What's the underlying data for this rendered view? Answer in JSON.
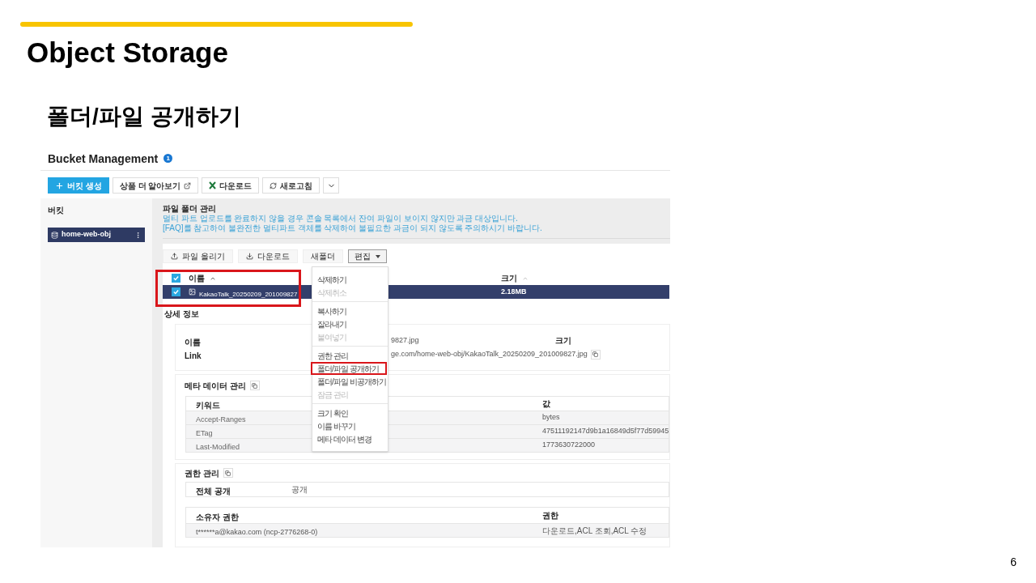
{
  "slide": {
    "title": "Object Storage",
    "subtitle": "폴더/파일 공개하기",
    "page_number": "6"
  },
  "app": {
    "header": {
      "title": "Bucket Management",
      "badge": "1"
    },
    "toolbar": [
      {
        "label": "버킷 생성",
        "kind": "primary"
      },
      {
        "label": "상품 더 알아보기",
        "kind": "external"
      },
      {
        "label": "다운로드",
        "kind": "excel"
      },
      {
        "label": "새로고침",
        "kind": "refresh"
      },
      {
        "kind": "more"
      }
    ],
    "sidebar": {
      "title": "버킷",
      "items": [
        {
          "label": "home-web-obj",
          "selected": true
        }
      ]
    },
    "files": {
      "title": "파일 폴더 관리",
      "notes": [
        "멀티 파트 업로드를 완료하지 않을 경우 콘솔 목록에서 잔여 파일이 보이지 않지만 과금 대상입니다.",
        "[FAQ]를 참고하여 불완전한 멀티파트 객체를 삭제하여 불필요한 과금이 되지 않도록 주의하시기 바랍니다."
      ],
      "actions": [
        {
          "label": "파일 올리기",
          "kind": "upload"
        },
        {
          "label": "다운로드",
          "kind": "download"
        },
        {
          "label": "새폴더",
          "kind": "plain"
        },
        {
          "label": "편집",
          "kind": "dropdown"
        }
      ],
      "table": {
        "columns": [
          "이름",
          "크기"
        ],
        "header_checked": true,
        "rows": [
          {
            "name": "KakaoTalk_20250209_201009827",
            "size": "2.18MB",
            "checked": true,
            "selected": true,
            "highlighted": true
          }
        ]
      }
    },
    "details": {
      "title": "상세 정보",
      "fields": [
        {
          "label": "이름",
          "value": "9827.jpg"
        },
        {
          "label": "Link",
          "value": "ge.com/home-web-obj/KakaoTalk_20250209_201009827.jpg"
        }
      ],
      "size_label": "크기",
      "metadata": {
        "title": "메타 데이터 관리",
        "columns": [
          "키워드",
          "값"
        ],
        "rows": [
          {
            "key": "Accept-Ranges",
            "value": "bytes"
          },
          {
            "key": "ETag",
            "value": "47511192147d9b1a16849d5f77d59945"
          },
          {
            "key": "Last-Modified",
            "value": "1773630722000"
          }
        ]
      },
      "permissions": {
        "title": "권한 관리",
        "public_label": "전체 공개",
        "public_value": "공개",
        "columns": [
          "소유자 권한",
          "권한"
        ],
        "rows": [
          {
            "owner": "t******a@kakao.com (ncp-2776268-0)",
            "rights": "다운로드,ACL 조회,ACL 수정"
          }
        ]
      }
    },
    "edit_menu": {
      "groups": [
        [
          {
            "label": "삭제하기",
            "disabled": false,
            "highlighted": false
          },
          {
            "label": "삭제취소",
            "disabled": true,
            "highlighted": false
          }
        ],
        [
          {
            "label": "복사하기",
            "disabled": false,
            "highlighted": false
          },
          {
            "label": "잘라내기",
            "disabled": false,
            "highlighted": false
          },
          {
            "label": "붙여넣기",
            "disabled": true,
            "highlighted": false
          }
        ],
        [
          {
            "label": "권한 관리",
            "disabled": false,
            "highlighted": false
          },
          {
            "label": "폴더/파일 공개하기",
            "disabled": false,
            "highlighted": true
          },
          {
            "label": "폴더/파일 비공개하기",
            "disabled": false,
            "highlighted": false
          },
          {
            "label": "잠금 관리",
            "disabled": true,
            "highlighted": false
          }
        ],
        [
          {
            "label": "크기 확인",
            "disabled": false,
            "highlighted": false
          },
          {
            "label": "이름 바꾸기",
            "disabled": false,
            "highlighted": false
          },
          {
            "label": "메타 데이터 변경",
            "disabled": false,
            "highlighted": false
          }
        ]
      ]
    }
  }
}
